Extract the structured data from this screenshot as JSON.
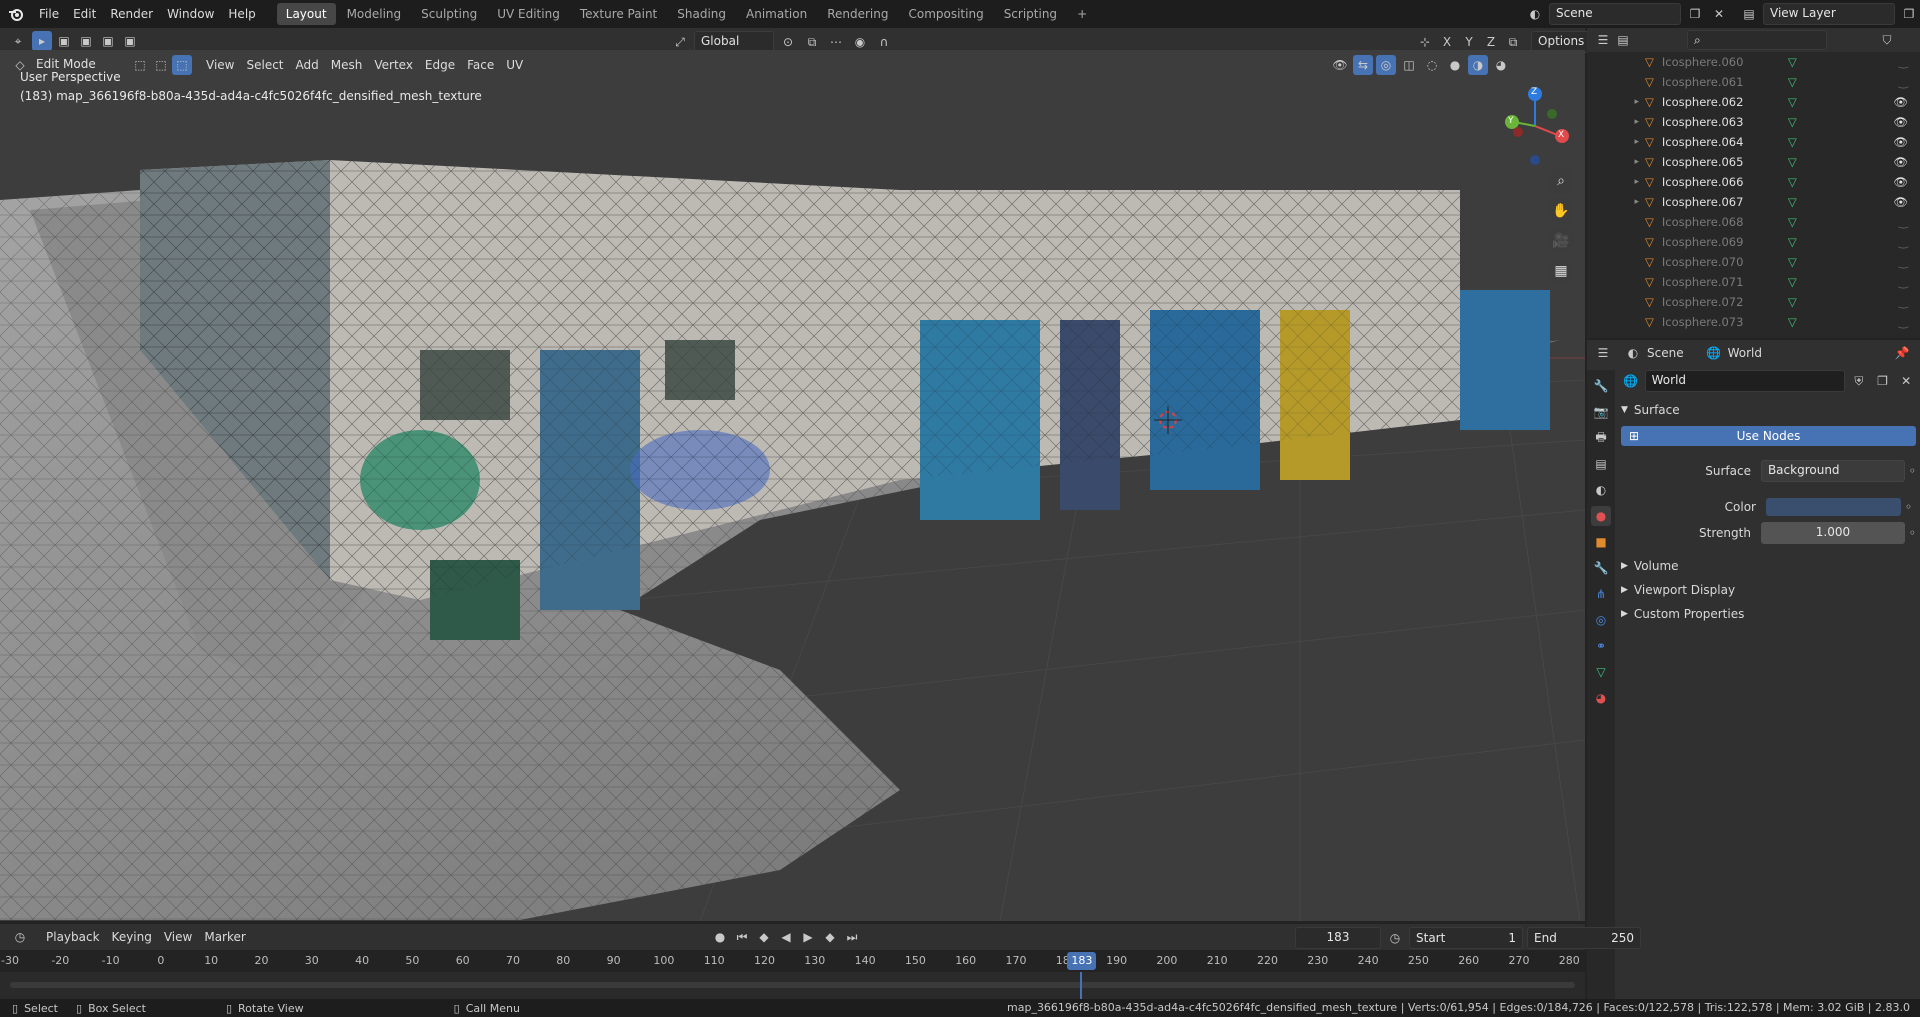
{
  "topbar": {
    "menus": [
      "File",
      "Edit",
      "Render",
      "Window",
      "Help"
    ],
    "workspaces": [
      "Layout",
      "Modeling",
      "Sculpting",
      "UV Editing",
      "Texture Paint",
      "Shading",
      "Animation",
      "Rendering",
      "Compositing",
      "Scripting"
    ],
    "active_workspace": "Layout",
    "scene": "Scene",
    "view_layer": "View Layer"
  },
  "viewport": {
    "mode": "Edit Mode",
    "menus": [
      "View",
      "Select",
      "Add",
      "Mesh",
      "Vertex",
      "Edge",
      "Face",
      "UV"
    ],
    "transform_orientation": "Global",
    "options_label": "Options",
    "axes": [
      "X",
      "Y",
      "Z"
    ],
    "perspective": "User Perspective",
    "object_info": "(183) map_366196f8-b80a-435d-ad4a-c4fc5026f4fc_densified_mesh_texture",
    "gizmo_axes": [
      "Z",
      "Y",
      "X"
    ]
  },
  "outliner": {
    "items": [
      {
        "name": "Icosphere.060",
        "visible": false
      },
      {
        "name": "Icosphere.061",
        "visible": false
      },
      {
        "name": "Icosphere.062",
        "visible": true
      },
      {
        "name": "Icosphere.063",
        "visible": true
      },
      {
        "name": "Icosphere.064",
        "visible": true
      },
      {
        "name": "Icosphere.065",
        "visible": true
      },
      {
        "name": "Icosphere.066",
        "visible": true
      },
      {
        "name": "Icosphere.067",
        "visible": true
      },
      {
        "name": "Icosphere.068",
        "visible": false
      },
      {
        "name": "Icosphere.069",
        "visible": false
      },
      {
        "name": "Icosphere.070",
        "visible": false
      },
      {
        "name": "Icosphere.071",
        "visible": false
      },
      {
        "name": "Icosphere.072",
        "visible": false
      },
      {
        "name": "Icosphere.073",
        "visible": false
      }
    ]
  },
  "properties": {
    "breadcrumb_scene": "Scene",
    "breadcrumb_world": "World",
    "world_name": "World",
    "surface_section": "Surface",
    "use_nodes": "Use Nodes",
    "surface_label": "Surface",
    "surface_value": "Background",
    "color_label": "Color",
    "strength_label": "Strength",
    "strength_value": "1.000",
    "volume_section": "Volume",
    "viewport_display_section": "Viewport Display",
    "custom_properties_section": "Custom Properties",
    "world_color": "#3a4f6e"
  },
  "timeline": {
    "menus": [
      "Playback",
      "Keying",
      "View",
      "Marker"
    ],
    "current_frame": "183",
    "start_label": "Start",
    "start_value": "1",
    "end_label": "End",
    "end_value": "250",
    "ticks": [
      "-30",
      "-20",
      "-10",
      "0",
      "10",
      "20",
      "30",
      "40",
      "50",
      "60",
      "70",
      "80",
      "90",
      "100",
      "110",
      "120",
      "130",
      "140",
      "150",
      "160",
      "170",
      "180",
      "190",
      "200",
      "210",
      "220",
      "230",
      "240",
      "250",
      "260",
      "270",
      "280"
    ],
    "playhead_label": "183"
  },
  "statusbar": {
    "select": "Select",
    "box_select": "Box Select",
    "rotate_view": "Rotate View",
    "call_menu": "Call Menu",
    "stats": "map_366196f8-b80a-435d-ad4a-c4fc5026f4fc_densified_mesh_texture | Verts:0/61,954 | Edges:0/184,726 | Faces:0/122,578 | Tris:122,578 | Mem: 3.02 GiB | 2.83.0"
  }
}
